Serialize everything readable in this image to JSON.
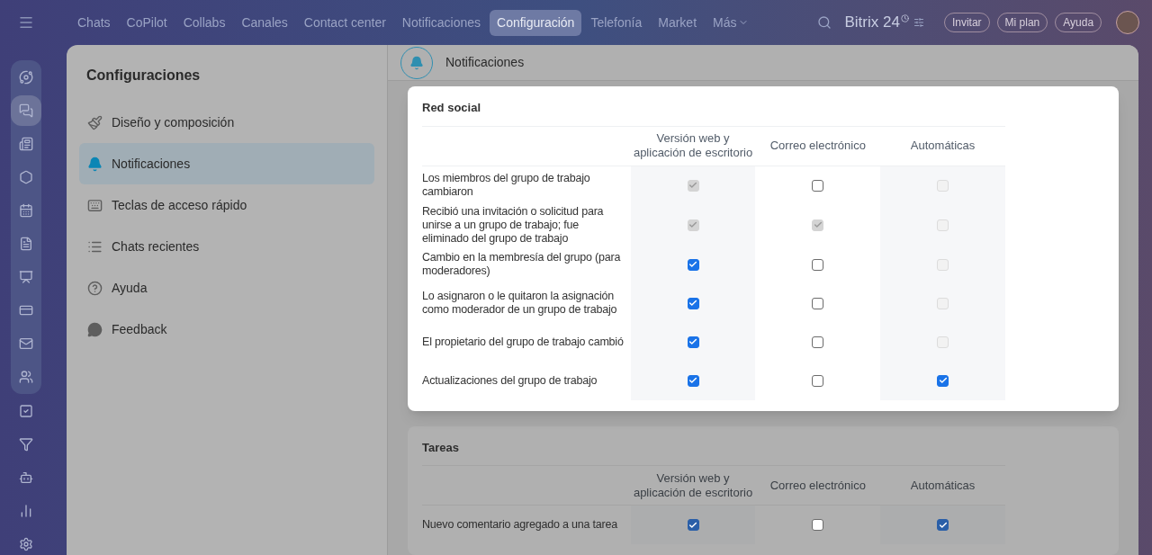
{
  "top_nav": {
    "items": [
      {
        "label": "Chats",
        "selected": false
      },
      {
        "label": "CoPilot",
        "selected": false
      },
      {
        "label": "Collabs",
        "selected": false
      },
      {
        "label": "Canales",
        "selected": false
      },
      {
        "label": "Contact center",
        "selected": false
      },
      {
        "label": "Notificaciones",
        "selected": false
      },
      {
        "label": "Configuración",
        "selected": true
      },
      {
        "label": "Telefonía",
        "selected": false
      },
      {
        "label": "Market",
        "selected": false
      }
    ],
    "more": "Más",
    "logo": "Bitrix 24",
    "buttons": [
      "Invitar",
      "Mi plan",
      "Ayuda"
    ]
  },
  "settings_menu": {
    "title": "Configuraciones",
    "items": [
      {
        "label": "Diseño y composición",
        "kind": "brush",
        "selected": false
      },
      {
        "label": "Notificaciones",
        "kind": "bell",
        "selected": true
      },
      {
        "label": "Teclas de acceso rápido",
        "kind": "keyboard",
        "selected": false
      },
      {
        "label": "Chats recientes",
        "kind": "list",
        "selected": false
      },
      {
        "label": "Ayuda",
        "kind": "help",
        "selected": false
      },
      {
        "label": "Feedback",
        "kind": "chat",
        "selected": false
      }
    ]
  },
  "header": {
    "title": "Notificaciones"
  },
  "sections": [
    {
      "title": "Red social",
      "highlighted": true,
      "columns": [
        "Versión web y aplicación de escritorio",
        "Correo electrónico",
        "Automáticas"
      ],
      "rows": [
        {
          "label": "Los miembros del grupo de trabajo cambiaron",
          "options": [
            {
              "checked": true,
              "disabled": true
            },
            {
              "checked": false,
              "disabled": false
            },
            {
              "checked": false,
              "disabled": true
            }
          ]
        },
        {
          "label": "Recibió una invitación o solicitud para unirse a un grupo de trabajo; fue eliminado del grupo de trabajo",
          "options": [
            {
              "checked": true,
              "disabled": true
            },
            {
              "checked": true,
              "disabled": true
            },
            {
              "checked": false,
              "disabled": true
            }
          ]
        },
        {
          "label": "Cambio en la membresía del grupo (para moderadores)",
          "options": [
            {
              "checked": true,
              "disabled": false
            },
            {
              "checked": false,
              "disabled": false
            },
            {
              "checked": false,
              "disabled": true
            }
          ]
        },
        {
          "label": "Lo asignaron o le quitaron la asignación como moderador de un grupo de trabajo",
          "options": [
            {
              "checked": true,
              "disabled": false
            },
            {
              "checked": false,
              "disabled": false
            },
            {
              "checked": false,
              "disabled": true
            }
          ]
        },
        {
          "label": "El propietario del grupo de trabajo cambió",
          "options": [
            {
              "checked": true,
              "disabled": false
            },
            {
              "checked": false,
              "disabled": false
            },
            {
              "checked": false,
              "disabled": true
            }
          ]
        },
        {
          "label": "Actualizaciones del grupo de trabajo",
          "options": [
            {
              "checked": true,
              "disabled": false
            },
            {
              "checked": false,
              "disabled": false
            },
            {
              "checked": true,
              "disabled": false
            }
          ]
        }
      ]
    },
    {
      "title": "Tareas",
      "highlighted": false,
      "columns": [
        "Versión web y aplicación de escritorio",
        "Correo electrónico",
        "Automáticas"
      ],
      "rows": [
        {
          "label": "Nuevo comentario agregado a una tarea",
          "options": [
            {
              "checked": true,
              "disabled": false
            },
            {
              "checked": false,
              "disabled": false
            },
            {
              "checked": true,
              "disabled": false
            }
          ]
        }
      ]
    }
  ]
}
